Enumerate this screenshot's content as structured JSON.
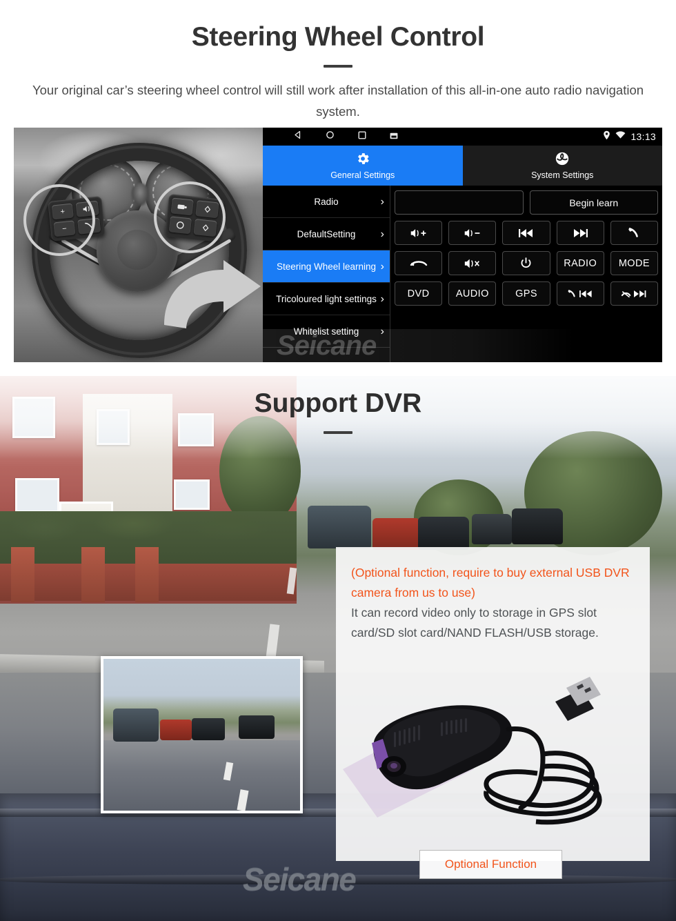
{
  "section1": {
    "title": "Steering Wheel Control",
    "subtitle": "Your original car’s steering wheel control will still work after installation of this all-in-one auto radio navigation system.",
    "photo_alt": "steering-wheel-with-highlighted-control-buttons"
  },
  "head_unit": {
    "status_bar": {
      "back_icon": "back-triangle-icon",
      "home_icon": "home-circle-icon",
      "recents_icon": "recents-square-icon",
      "screenshot_icon": "screenshot-icon",
      "location_icon": "location-pin-icon",
      "wifi_icon": "wifi-icon",
      "clock": "13:13"
    },
    "tabs": [
      {
        "label": "General Settings",
        "icon": "gear-icon",
        "active": true
      },
      {
        "label": "System Settings",
        "icon": "system-settings-icon",
        "active": false
      }
    ],
    "sidebar": [
      {
        "label": "Radio",
        "selected": false
      },
      {
        "label": "DefaultSetting",
        "selected": false
      },
      {
        "label": "Steering Wheel learning",
        "selected": true
      },
      {
        "label": "Tricoloured light settings",
        "selected": false
      },
      {
        "label": "Whitelist setting",
        "selected": false
      }
    ],
    "chevron": "›",
    "learn_input_value": "",
    "begin_learn_label": "Begin learn",
    "buttons": [
      {
        "label": "",
        "icon": "volume-up-icon"
      },
      {
        "label": "",
        "icon": "volume-down-icon"
      },
      {
        "label": "",
        "icon": "previous-track-icon"
      },
      {
        "label": "",
        "icon": "next-track-icon"
      },
      {
        "label": "",
        "icon": "phone-call-icon"
      },
      {
        "label": "",
        "icon": "phone-hangup-icon"
      },
      {
        "label": "",
        "icon": "mute-icon"
      },
      {
        "label": "",
        "icon": "power-icon"
      },
      {
        "label": "RADIO",
        "icon": ""
      },
      {
        "label": "MODE",
        "icon": ""
      },
      {
        "label": "DVD",
        "icon": ""
      },
      {
        "label": "AUDIO",
        "icon": ""
      },
      {
        "label": "GPS",
        "icon": ""
      },
      {
        "label": "",
        "icon": "phone-previous-icon"
      },
      {
        "label": "",
        "icon": "hangup-next-icon"
      }
    ],
    "watermark": "Seicane"
  },
  "section2": {
    "title": "Support DVR",
    "dashcam_alt": "dashcam-road-recording-preview",
    "product_alt": "usb-dvr-camera-with-cable",
    "info_orange": "(Optional function, require to buy external USB DVR camera from us to use)",
    "info_grey": "It can record video only to storage in GPS slot card/SD slot card/NAND FLASH/USB storage.",
    "optional_button": "Optional Function",
    "watermark": "Seicane"
  },
  "colors": {
    "accent_blue": "#1a7cf5",
    "accent_orange": "#f2541b",
    "highlight_yellow": "#ffd21e",
    "title_dark": "#333333"
  }
}
